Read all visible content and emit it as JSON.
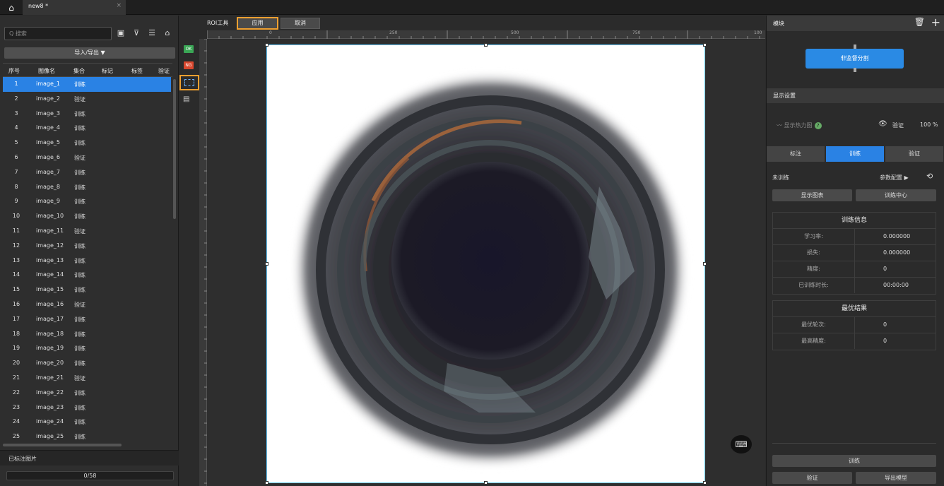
{
  "titlebar": {
    "tab_title": "new8 *",
    "close_glyph": "×"
  },
  "left": {
    "search_placeholder": "Q 搜索",
    "import_export": "导入/导出 ▼",
    "columns": [
      "序号",
      "图像名",
      "集合",
      "标记",
      "标签",
      "验证"
    ],
    "rows": [
      {
        "n": "1",
        "name": "image_1",
        "set": "训练"
      },
      {
        "n": "2",
        "name": "image_2",
        "set": "验证"
      },
      {
        "n": "3",
        "name": "image_3",
        "set": "训练"
      },
      {
        "n": "4",
        "name": "image_4",
        "set": "训练"
      },
      {
        "n": "5",
        "name": "image_5",
        "set": "训练"
      },
      {
        "n": "6",
        "name": "image_6",
        "set": "验证"
      },
      {
        "n": "7",
        "name": "image_7",
        "set": "训练"
      },
      {
        "n": "8",
        "name": "image_8",
        "set": "训练"
      },
      {
        "n": "9",
        "name": "image_9",
        "set": "训练"
      },
      {
        "n": "10",
        "name": "image_10",
        "set": "训练"
      },
      {
        "n": "11",
        "name": "image_11",
        "set": "验证"
      },
      {
        "n": "12",
        "name": "image_12",
        "set": "训练"
      },
      {
        "n": "13",
        "name": "image_13",
        "set": "训练"
      },
      {
        "n": "14",
        "name": "image_14",
        "set": "训练"
      },
      {
        "n": "15",
        "name": "image_15",
        "set": "训练"
      },
      {
        "n": "16",
        "name": "image_16",
        "set": "验证"
      },
      {
        "n": "17",
        "name": "image_17",
        "set": "训练"
      },
      {
        "n": "18",
        "name": "image_18",
        "set": "训练"
      },
      {
        "n": "19",
        "name": "image_19",
        "set": "训练"
      },
      {
        "n": "20",
        "name": "image_20",
        "set": "训练"
      },
      {
        "n": "21",
        "name": "image_21",
        "set": "验证"
      },
      {
        "n": "22",
        "name": "image_22",
        "set": "训练"
      },
      {
        "n": "23",
        "name": "image_23",
        "set": "训练"
      },
      {
        "n": "24",
        "name": "image_24",
        "set": "训练"
      },
      {
        "n": "25",
        "name": "image_25",
        "set": "训练"
      }
    ],
    "selected_row": 0,
    "labeled_images": "已标注图片",
    "progress": "0/58"
  },
  "tools": {
    "ok": "OK",
    "ng": "NG"
  },
  "roi": {
    "label": "ROI工具",
    "apply": "应用",
    "cancel": "取消"
  },
  "ruler": {
    "h_labels": [
      "0",
      "250",
      "500",
      "750",
      "100"
    ]
  },
  "right": {
    "module_header": "模块",
    "module_button": "非监督分割",
    "display_header": "显示设置",
    "heatmap": "显示热力图",
    "view_set": "验证",
    "percent": "100 %",
    "tabs": [
      "标注",
      "训练",
      "验证"
    ],
    "active_tab": 1,
    "status": "未训练",
    "params": "参数配置 ▶",
    "show_chart": "显示图表",
    "train_center": "训练中心",
    "train_info": {
      "title": "训练信息",
      "rows": [
        {
          "k": "学习率:",
          "v": "0.000000"
        },
        {
          "k": "损失:",
          "v": "0.000000"
        },
        {
          "k": "精度:",
          "v": "0"
        },
        {
          "k": "已训练时长:",
          "v": "00:00:00"
        }
      ]
    },
    "best": {
      "title": "最优结果",
      "rows": [
        {
          "k": "最优轮次:",
          "v": "0"
        },
        {
          "k": "最高精度:",
          "v": "0"
        }
      ]
    },
    "train_btn": "训练",
    "validate_btn": "验证",
    "export_btn": "导出模型"
  },
  "colors": {
    "accent": "#2a82e4",
    "highlight": "#f0a030",
    "ok_green": "#3aa655",
    "ng_red": "#d9472e"
  }
}
